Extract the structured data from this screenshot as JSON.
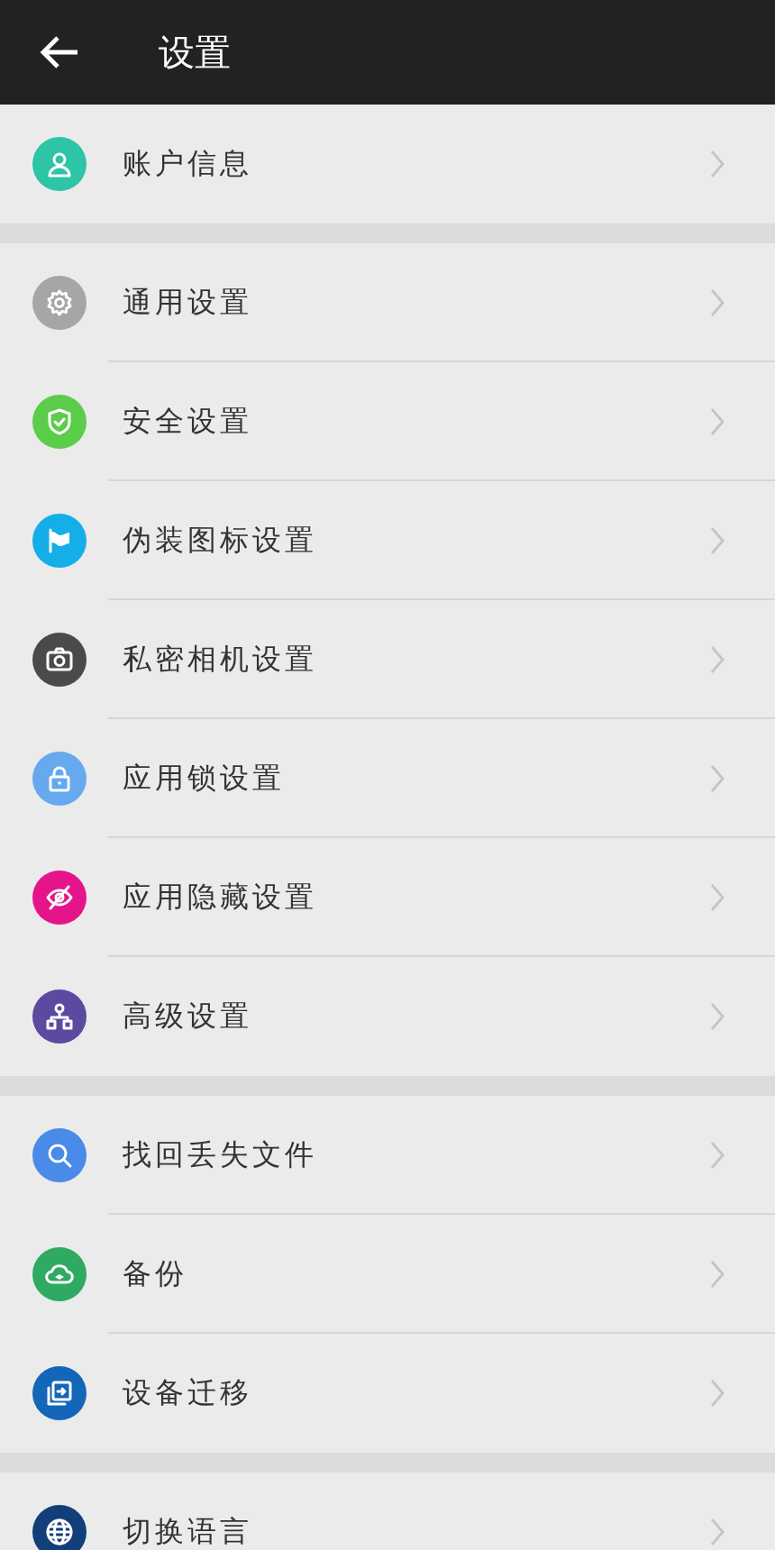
{
  "header": {
    "title": "设置"
  },
  "groups": [
    {
      "items": [
        {
          "label": "账户信息",
          "color": "#2ec4a6"
        }
      ]
    },
    {
      "items": [
        {
          "label": "通用设置",
          "color": "#a6a6a6"
        },
        {
          "label": "安全设置",
          "color": "#5ccc4b"
        },
        {
          "label": "伪装图标设置",
          "color": "#14aee8"
        },
        {
          "label": "私密相机设置",
          "color": "#4a4a4a"
        },
        {
          "label": "应用锁设置",
          "color": "#66a9ee"
        },
        {
          "label": "应用隐藏设置",
          "color": "#e6148a"
        },
        {
          "label": "高级设置",
          "color": "#5b4aa0"
        }
      ]
    },
    {
      "items": [
        {
          "label": "找回丢失文件",
          "color": "#4a8ae8"
        },
        {
          "label": "备份",
          "color": "#2eaa62"
        },
        {
          "label": "设备迁移",
          "color": "#1466b8"
        }
      ]
    },
    {
      "items": [
        {
          "label": "切换语言",
          "color": "#123e7a"
        }
      ]
    }
  ]
}
